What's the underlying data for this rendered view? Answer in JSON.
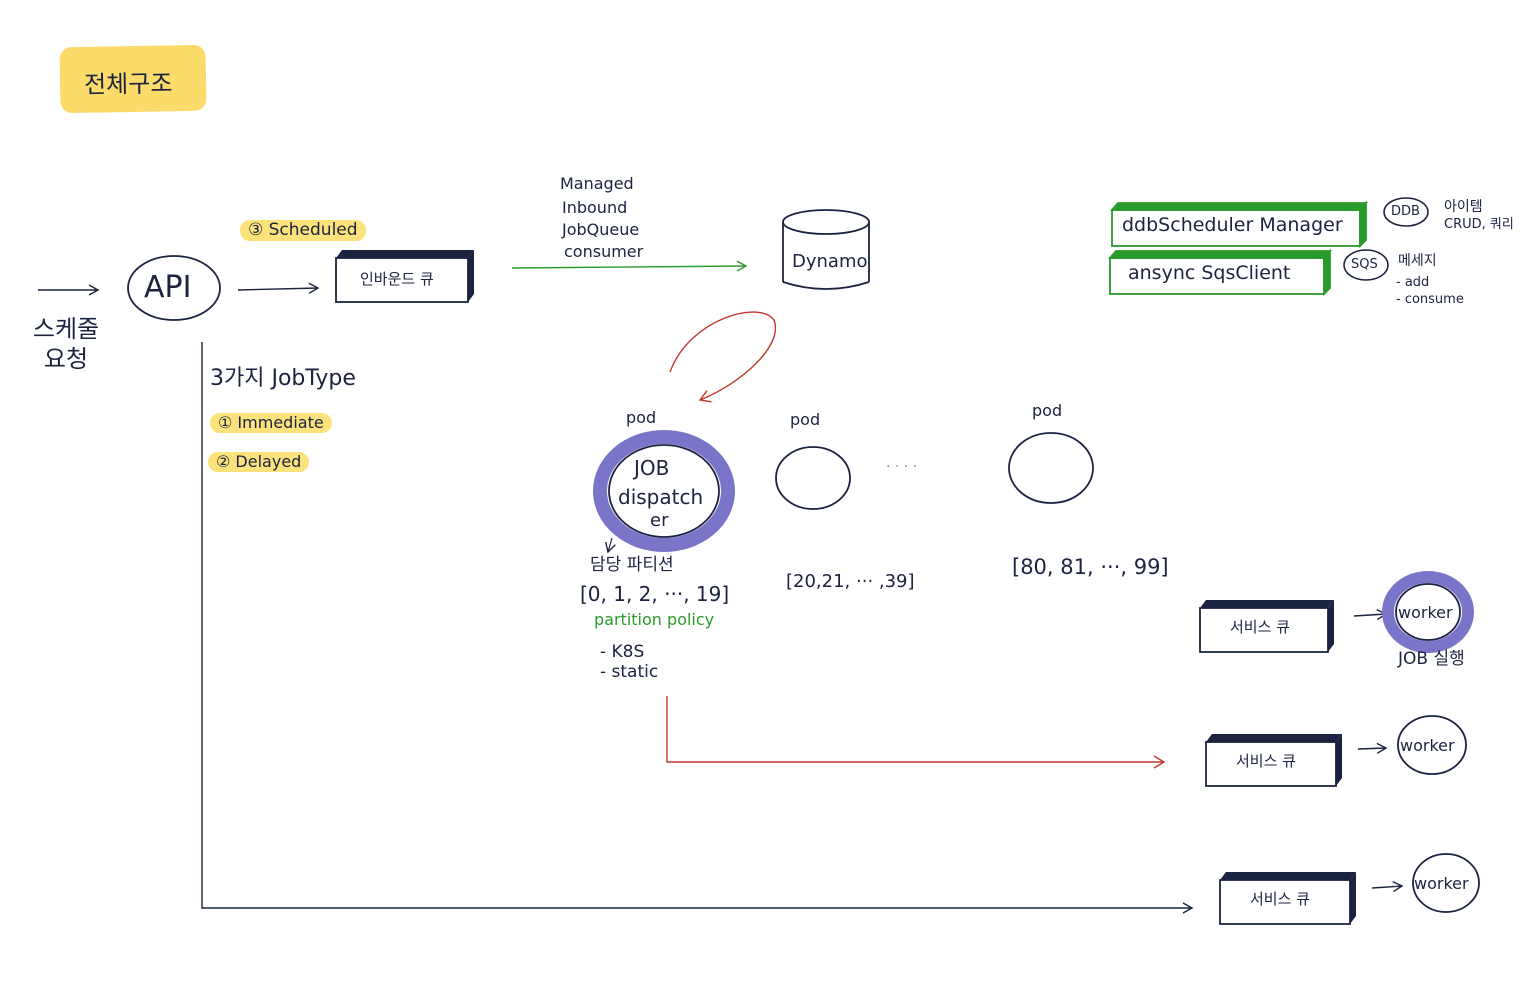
{
  "title": "전체구조",
  "request_label": "스케줄\n요청",
  "api": "API",
  "scheduled_tag": "③ Scheduled",
  "inbound_queue": "인바운드 큐",
  "consumer_label": [
    "Managed",
    "Inbound",
    "JobQueue",
    "consumer"
  ],
  "dynamo": "Dynamo",
  "jobtype_heading": "3가지 JobType",
  "jobtypes": [
    "① Immediate",
    "② Delayed"
  ],
  "pod_label": "pod",
  "dispatcher": [
    "JOB",
    "dispatch",
    "er"
  ],
  "ellipsis": "· · · ·",
  "partition_heading": "담당 파티션",
  "partitions": [
    "[0, 1, 2, ···, 19]",
    "[20,21, ··· ,39]",
    "[80, 81, ···, 99]"
  ],
  "partition_policy": {
    "title": "partition policy",
    "items": [
      "- K8S",
      "- static"
    ]
  },
  "components": {
    "ddb_manager": "ddbScheduler Manager",
    "sqs_client": "ansync SqsClient",
    "ddb_tag": "DDB",
    "ddb_desc": [
      "아이템",
      "CRUD, 쿼리"
    ],
    "sqs_tag": "SQS",
    "sqs_desc": [
      "메세지",
      "- add",
      "- consume"
    ]
  },
  "service_queue": "서비스 큐",
  "worker": "worker",
  "job_exec": "JOB 실행",
  "colors": {
    "ink": "#1c2340",
    "highlight": "#fbe27a",
    "accent_purple": "#7b75c9",
    "green": "#2a9a2a",
    "red": "#c0392b"
  }
}
